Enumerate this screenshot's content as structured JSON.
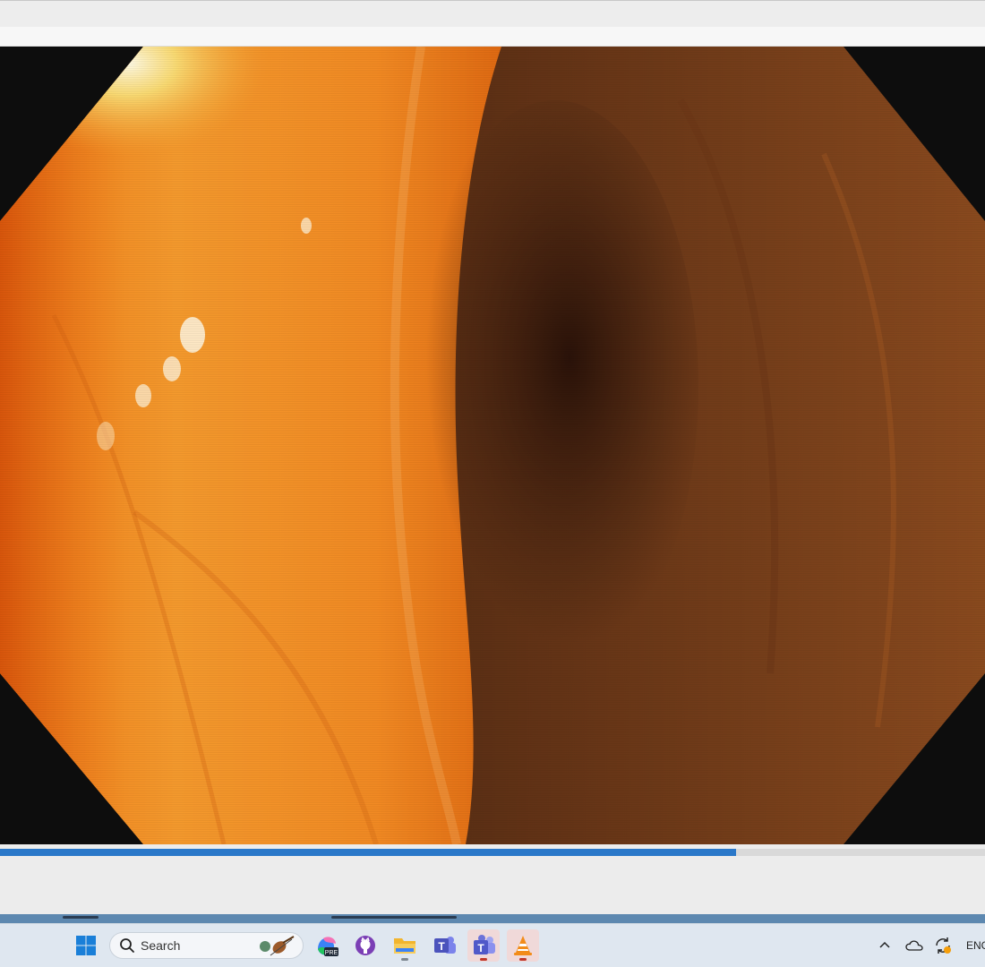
{
  "player": {
    "progress_fraction": 0.747
  },
  "taskbar": {
    "search": {
      "label": "Search"
    },
    "apps": [
      {
        "icon": "copilot-pre-icon",
        "badge": "PRE"
      },
      {
        "icon": "github-desktop-icon"
      },
      {
        "icon": "file-explorer-icon"
      },
      {
        "icon": "teams-classic-icon",
        "letter": "T"
      },
      {
        "icon": "teams-icon",
        "letter": "T"
      },
      {
        "icon": "vlc-icon"
      }
    ],
    "tray": {
      "language": "ENG"
    }
  },
  "colors": {
    "accent": "#2a78c9",
    "taskbar": "#dfe7f0"
  }
}
